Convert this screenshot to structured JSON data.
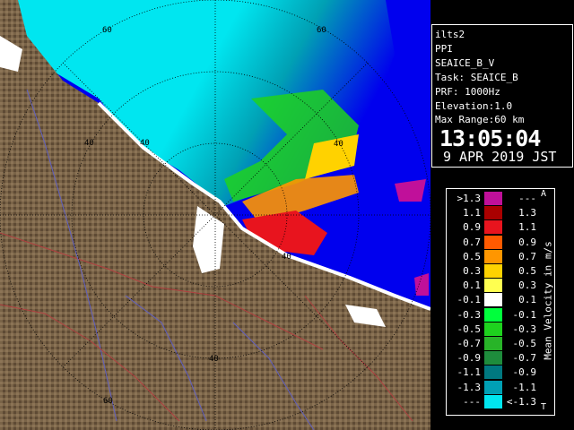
{
  "info": {
    "radar": "ilts2",
    "product": "PPI",
    "scan": "SEAICE_B_V",
    "task": "Task: SEAICE_B",
    "prf": "PRF: 1000Hz",
    "elevation": "Elevation:1.0",
    "max_range": "Max Range:60 km",
    "time": "13:05:04",
    "date": "9 APR 2019 JST"
  },
  "map": {
    "range_labels": [
      "60",
      "60",
      "40",
      "40",
      "40",
      "40",
      "40",
      "60"
    ],
    "colors": {
      "sea": "#0000ee",
      "land": "#7a6448",
      "ice": "#ffffff"
    }
  },
  "legend": {
    "title": "Mean Velocity in m/s",
    "corner_top": "A",
    "corner_bottom": "T",
    "rows": [
      {
        "lo": ">1.3",
        "hi": "---",
        "color": "#c0109a"
      },
      {
        "lo": "1.1",
        "hi": "1.3",
        "color": "#aa0000"
      },
      {
        "lo": "0.9",
        "hi": "1.1",
        "color": "#e8141e"
      },
      {
        "lo": "0.7",
        "hi": "0.9",
        "color": "#ff5a00"
      },
      {
        "lo": "0.5",
        "hi": "0.7",
        "color": "#ff9600"
      },
      {
        "lo": "0.3",
        "hi": "0.5",
        "color": "#ffd200"
      },
      {
        "lo": "0.1",
        "hi": "0.3",
        "color": "#ffff50"
      },
      {
        "lo": "-0.1",
        "hi": "0.1",
        "color": "#ffffff"
      },
      {
        "lo": "-0.3",
        "hi": "-0.1",
        "color": "#00ff3c"
      },
      {
        "lo": "-0.5",
        "hi": "-0.3",
        "color": "#1ed21e"
      },
      {
        "lo": "-0.7",
        "hi": "-0.5",
        "color": "#28b428"
      },
      {
        "lo": "-0.9",
        "hi": "-0.7",
        "color": "#1e8c3c"
      },
      {
        "lo": "-1.1",
        "hi": "-0.9",
        "color": "#007880"
      },
      {
        "lo": "-1.3",
        "hi": "-1.1",
        "color": "#00a0b4"
      },
      {
        "lo": "---",
        "hi": "<-1.3",
        "color": "#00e6f0"
      }
    ]
  }
}
